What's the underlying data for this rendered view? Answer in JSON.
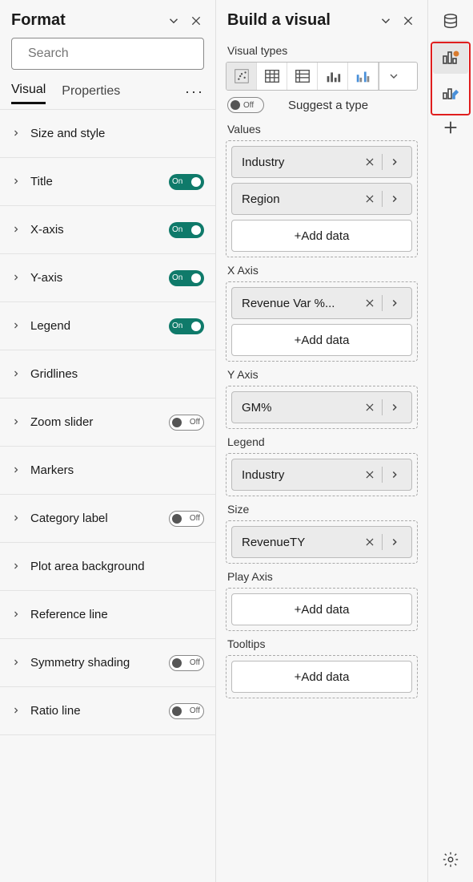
{
  "format": {
    "title": "Format",
    "search_placeholder": "Search",
    "tabs": {
      "visual": "Visual",
      "properties": "Properties"
    },
    "toggle_on": "On",
    "toggle_off": "Off",
    "items": [
      {
        "label": "Size and style",
        "toggle": null
      },
      {
        "label": "Title",
        "toggle": "on"
      },
      {
        "label": "X-axis",
        "toggle": "on"
      },
      {
        "label": "Y-axis",
        "toggle": "on"
      },
      {
        "label": "Legend",
        "toggle": "on"
      },
      {
        "label": "Gridlines",
        "toggle": null
      },
      {
        "label": "Zoom slider",
        "toggle": "off"
      },
      {
        "label": "Markers",
        "toggle": null
      },
      {
        "label": "Category label",
        "toggle": "off"
      },
      {
        "label": "Plot area background",
        "toggle": null
      },
      {
        "label": "Reference line",
        "toggle": null
      },
      {
        "label": "Symmetry shading",
        "toggle": "off"
      },
      {
        "label": "Ratio line",
        "toggle": "off"
      }
    ]
  },
  "build": {
    "title": "Build a visual",
    "visual_types_label": "Visual types",
    "suggest_off": "Off",
    "suggest_label": "Suggest a type",
    "add_data": "+Add data",
    "wells": [
      {
        "label": "Values",
        "fields": [
          "Industry",
          "Region"
        ],
        "add": true
      },
      {
        "label": "X Axis",
        "fields": [
          "Revenue Var %..."
        ],
        "add": true
      },
      {
        "label": "Y Axis",
        "fields": [
          "GM%"
        ],
        "add": false
      },
      {
        "label": "Legend",
        "fields": [
          "Industry"
        ],
        "add": false
      },
      {
        "label": "Size",
        "fields": [
          "RevenueTY"
        ],
        "add": false
      },
      {
        "label": "Play Axis",
        "fields": [],
        "add": true
      },
      {
        "label": "Tooltips",
        "fields": [],
        "add": true
      }
    ]
  }
}
